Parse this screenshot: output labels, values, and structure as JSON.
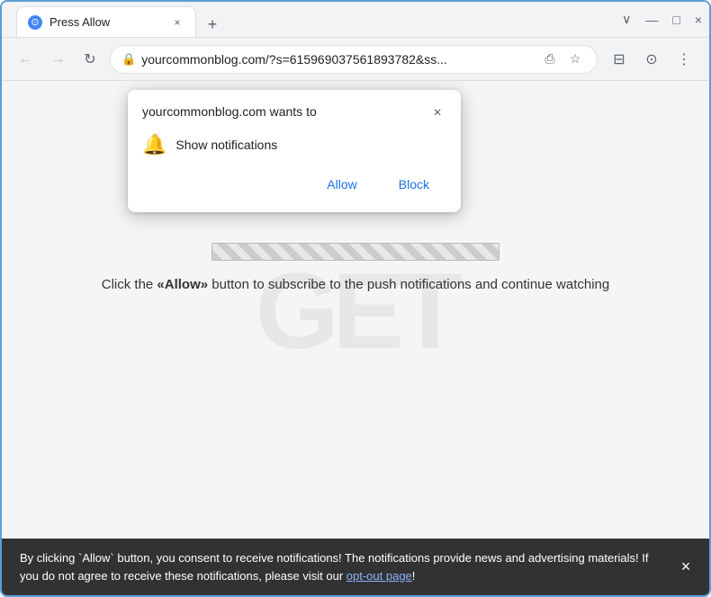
{
  "browser": {
    "title_bar": {
      "tab_title": "Press Allow",
      "tab_favicon": "⊙",
      "tab_close": "×",
      "new_tab": "+",
      "win_minimize": "—",
      "win_maximize": "□",
      "win_close": "×",
      "win_chevron": "∨"
    },
    "address_bar": {
      "back_btn": "←",
      "forward_btn": "→",
      "reload_btn": "↻",
      "url": "yourcommonblog.com/?s=615969037561893782&ss...",
      "lock_icon": "🔒",
      "share_icon": "⎙",
      "bookmark_icon": "☆",
      "extension_icon": "⊟",
      "profile_icon": "⊙",
      "menu_icon": "⋮"
    }
  },
  "permission_dialog": {
    "title": "yourcommonblog.com wants to",
    "close_icon": "×",
    "body_text": "Show notifications",
    "bell_icon": "🔔",
    "allow_btn": "Allow",
    "block_btn": "Block"
  },
  "page": {
    "instruction": "Click the «Allow» button to subscribe to the push notifications and continue watching",
    "watermark_text": "GET"
  },
  "bottom_bar": {
    "text_before_link": "By clicking `Allow` button, you consent to receive notifications! The notifications provide news and advertising materials! If you do not agree to receive these notifications, please visit our ",
    "link_text": "opt-out page",
    "text_after_link": "!",
    "close_icon": "×"
  }
}
